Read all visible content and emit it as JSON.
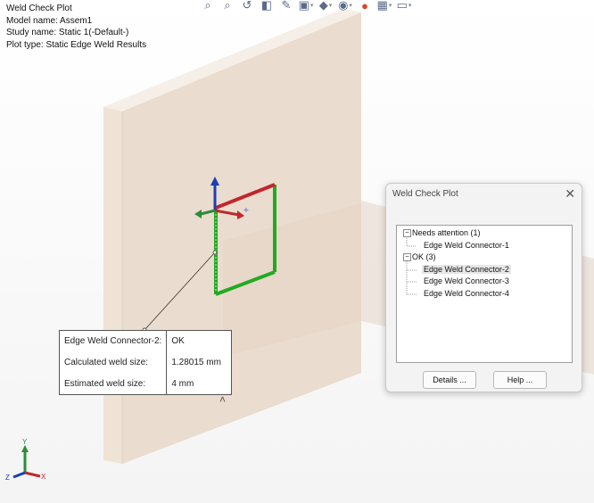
{
  "info": {
    "plot_title": "Weld Check Plot",
    "model_name": "Model name: Assem1",
    "study_name": "Study name: Static 1(-Default-)",
    "plot_type": "Plot type: Static Edge Weld Results"
  },
  "toolbar": {
    "icons": [
      "zoom-to-fit-icon",
      "zoom-area-icon",
      "previous-view-icon",
      "section-view-icon",
      "dynamic-annotation-icon",
      "view-orientation-icon",
      "display-style-icon",
      "hide-show-icon",
      "appearance-icon",
      "scene-icon",
      "display-icon"
    ]
  },
  "dialog": {
    "title": "Weld Check Plot",
    "close_glyph": "✕",
    "tree": {
      "group1_label": "Needs attention (1)",
      "group1_items": [
        "Edge Weld Connector-1"
      ],
      "group2_label": "OK (3)",
      "group2_items": [
        "Edge Weld Connector-2",
        "Edge Weld Connector-3",
        "Edge Weld Connector-4"
      ],
      "selected": "Edge Weld Connector-2",
      "expander_glyph": "−"
    },
    "details_label": "Details ...",
    "help_label": "Help ..."
  },
  "callout": {
    "rows": [
      {
        "key": "Edge Weld Connector-2:",
        "value": "OK"
      },
      {
        "key": "Calculated weld size:",
        "value": "1.28015 mm"
      },
      {
        "key": "Estimated weld size:",
        "value": "4 mm"
      }
    ],
    "collapse_glyph": "˄"
  },
  "triad": {
    "x": "X",
    "y": "Y",
    "z": "Z"
  },
  "colors": {
    "x_axis": "#c0272d",
    "y_axis": "#2e8b3a",
    "z_axis": "#1b3fb5",
    "weld_ok": "#22aa22",
    "plate": "#efe3d6"
  }
}
